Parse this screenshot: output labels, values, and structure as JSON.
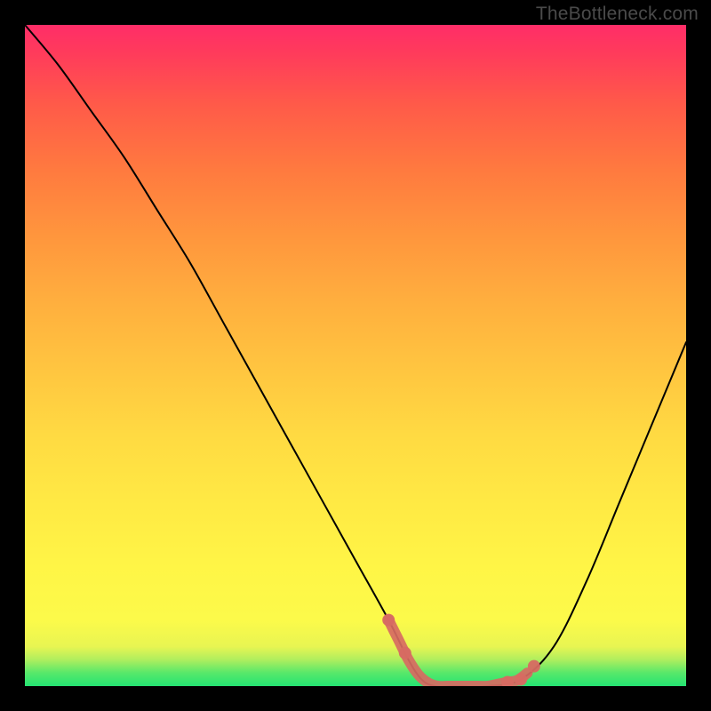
{
  "watermark": "TheBottleneck.com",
  "chart_data": {
    "type": "line",
    "title": "",
    "xlabel": "",
    "ylabel": "",
    "xlim": [
      0,
      100
    ],
    "ylim": [
      0,
      100
    ],
    "x": [
      0,
      5,
      10,
      15,
      20,
      25,
      30,
      35,
      40,
      45,
      50,
      55,
      58,
      60,
      62,
      65,
      70,
      75,
      80,
      85,
      90,
      95,
      100
    ],
    "values": [
      100,
      94,
      87,
      80,
      72,
      64,
      55,
      46,
      37,
      28,
      19,
      10,
      4,
      1,
      0,
      0,
      0,
      1,
      6,
      16,
      28,
      40,
      52
    ],
    "highlight_band": {
      "y_from": 0,
      "y_to": 4
    },
    "highlight_segment": {
      "x_from": 55,
      "x_to": 76,
      "stroke": "#d76a62"
    }
  },
  "colors": {
    "background": "#000000",
    "curve": "#000000",
    "highlight": "#d76a62",
    "gradient_top": "#ff2d68",
    "gradient_bottom": "#24e472"
  }
}
